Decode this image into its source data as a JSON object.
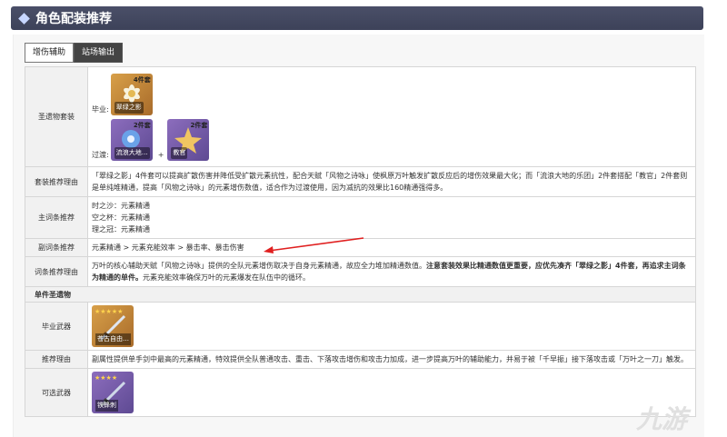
{
  "header": {
    "title": "角色配装推荐"
  },
  "tabs": [
    {
      "label": "增伤辅助",
      "active": true
    },
    {
      "label": "站场输出",
      "active": false
    }
  ],
  "rows": {
    "artifact_set": {
      "label": "圣遗物套装",
      "best_label": "毕业:",
      "transition_label": "过渡:",
      "best": {
        "badge": "4件套",
        "name": "翠绿之影"
      },
      "transition": [
        {
          "badge": "2件套",
          "name": "流浪大地…"
        },
        {
          "badge": "2件套",
          "name": "教官"
        }
      ]
    },
    "set_reason": {
      "label": "套装推荐理由",
      "text": "「翠绿之影」4件套可以提高扩散伤害并降低受扩散元素抗性，配合天赋「风物之诗咏」使枫原万叶触发扩散反应后的增伤效果最大化；而「流浪大地的乐团」2件套搭配「教官」2件套则是单纯堆精通，提高「风物之诗咏」的元素增伤数值，适合作为过渡使用，因为减抗的效果比160精通强得多。"
    },
    "main_stats": {
      "label": "主词条推荐",
      "lines": [
        "时之沙：元素精通",
        "空之杯：元素精通",
        "理之冠：元素精通"
      ]
    },
    "sub_stats": {
      "label": "副词条推荐",
      "text": "元素精通 > 元素充能效率 > 暴击率、暴击伤害"
    },
    "stat_reason": {
      "label": "词条推荐理由",
      "text_normal": "万叶的核心辅助天赋「风物之诗咏」提供的全队元素增伤取决于自身元素精通，故应全力堆加精通数值。",
      "text_bold": "注意套装效果比精通数值更重要，应优先凑齐「翠绿之影」4件套，再追求主词条为精通的单件。",
      "text_tail": "元素充能效率确保万叶的元素爆发在队伍中的循环。"
    },
    "single_section": {
      "label": "单件圣遗物"
    },
    "best_weapon": {
      "label": "毕业武器",
      "stars": "★★★★★",
      "name": "苍古自由…"
    },
    "weapon_reason": {
      "label": "推荐理由",
      "text": "副属性提供单手剑中最高的元素精通，特效提供全队普通攻击、重击、下落攻击增伤和攻击力加成，进一步提高万叶的辅助能力，并易于被「千早振」接下落攻击或「万叶之一刀」触发。"
    },
    "alt_weapon": {
      "label": "可选武器",
      "stars": "★★★★",
      "name": "铁蜂刺"
    }
  },
  "watermark": "九游",
  "colors": {
    "banner": "#444960",
    "arrow": "#e02020"
  }
}
